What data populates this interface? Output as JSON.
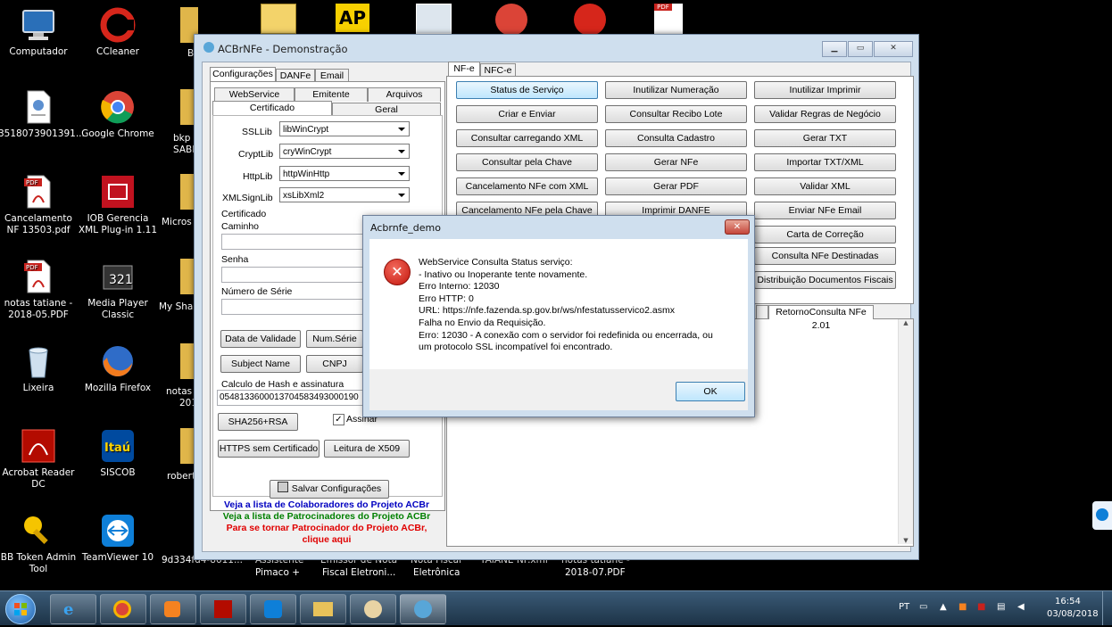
{
  "desktop": {
    "icons": [
      {
        "label": "Computador",
        "icon": "computer-icon"
      },
      {
        "label": "CCleaner",
        "icon": "ccleaner-icon"
      },
      {
        "label": "3518073901391...",
        "icon": "xml-file-icon"
      },
      {
        "label": "Google Chrome",
        "icon": "chrome-icon"
      },
      {
        "label": "Cancelamento NF 13503.pdf",
        "icon": "pdf-icon"
      },
      {
        "label": "IOB Gerencia XML Plug-in 1.11",
        "icon": "iob-icon"
      },
      {
        "label": "notas tatiane - 2018-05.PDF",
        "icon": "pdf-icon"
      },
      {
        "label": "Media Player Classic",
        "icon": "media-player-icon"
      },
      {
        "label": "Lixeira",
        "icon": "recycle-bin-icon"
      },
      {
        "label": "Mozilla Firefox",
        "icon": "firefox-icon"
      },
      {
        "label": "Acrobat Reader DC",
        "icon": "acrobat-icon"
      },
      {
        "label": "SISCOB",
        "icon": "itau-icon"
      },
      {
        "label": "BB Token Admin Tool",
        "icon": "bb-token-icon"
      },
      {
        "label": "TeamViewer 10",
        "icon": "teamviewer-icon"
      }
    ],
    "partial_labels": {
      "p1": "B",
      "p2": "bkp -",
      "p3": "SABE",
      "p4": "Micros",
      "p5": "My Shar",
      "p6": "notas",
      "p7": "201",
      "p8": "robert",
      "b1": "9d334fd4-8611...",
      "b2": "Assistente",
      "b3": "Pimaco +",
      "b4": "Emissor de Nota",
      "b5": "Fiscal Eletroni...",
      "b6": "Nota Fiscal",
      "b7": "Eletrônica",
      "b8": "TAIANE NF.xml",
      "b9": "notas tatiane -",
      "b10": "2018-07.PDF"
    },
    "top_badge": "AP",
    "top_pdf": "PDF"
  },
  "app": {
    "title": "ACBrNFe - Demonstração",
    "left_tabs": [
      "Configurações",
      "DANFe",
      "Email"
    ],
    "sub_tabs_row1": [
      "WebService",
      "Emitente",
      "Arquivos"
    ],
    "sub_tabs_row2": [
      "Certificado",
      "Geral"
    ],
    "ssl": {
      "label": "SSLLib",
      "value": "libWinCrypt"
    },
    "crypt": {
      "label": "CryptLib",
      "value": "cryWinCrypt"
    },
    "http": {
      "label": "HttpLib",
      "value": "httpWinHttp"
    },
    "xmlsign": {
      "label": "XMLSignLib",
      "value": "xsLibXml2"
    },
    "cert_group": "Certificado",
    "caminho": "Caminho",
    "senha": "Senha",
    "numero_serie": "Número de Série",
    "btn_data_validade": "Data de Validade",
    "btn_num_serie": "Num.Série",
    "btn_subject": "Subject Name",
    "btn_cnpj": "CNPJ",
    "hash_group": "Calculo de Hash e assinatura",
    "hash_value": "05481336000137045834930001​90",
    "btn_sha": "SHA256+RSA",
    "assinar": "Assinar",
    "btn_https": "HTTPS sem Certificado",
    "btn_x509": "Leitura de X509",
    "btn_salvar": "Salvar Configurações",
    "link_colab": "Veja a lista de Colaboradores do Projeto ACBr",
    "link_patro": "Veja a lista de Patrocinadores do Projeto ACBr",
    "link_tornar1": "Para se tornar Patrocinador do Projeto ACBr,",
    "link_tornar2": "clique aqui",
    "right_tabs": [
      "NF-e",
      "NFC-e"
    ],
    "actions": [
      [
        "Status de Serviço",
        "Inutilizar Numeração",
        "Inutilizar Imprimir"
      ],
      [
        "Criar e Enviar",
        "Consultar Recibo Lote",
        "Validar Regras de Negócio"
      ],
      [
        "Consultar carregando XML",
        "Consulta Cadastro",
        "Gerar TXT"
      ],
      [
        "Consultar pela Chave",
        "Gerar NFe",
        "Importar TXT/XML"
      ],
      [
        "Cancelamento NFe com XML",
        "Gerar PDF",
        "Validar XML"
      ],
      [
        "Cancelamento NFe pela Chave",
        "Imprimir DANFE",
        "Enviar NFe Email"
      ],
      [
        "",
        "",
        "Carta de Correção"
      ],
      [
        "",
        "",
        "Consulta NFe Destinadas"
      ],
      [
        "",
        "",
        "Distribuição Documentos Fiscais"
      ]
    ],
    "result_tab": "RetornoConsulta NFe 2.01"
  },
  "dialog": {
    "title": "Acbrnfe_demo",
    "message": "WebService Consulta Status serviço:\n- Inativo ou Inoperante tente novamente.\nErro Interno: 12030\nErro HTTP: 0\nURL: https://nfe.fazenda.sp.gov.br/ws/nfestatusservico2.asmx\nFalha no Envio da Requisição.\nErro: 12030 - A conexão com o servidor foi redefinida ou encerrada, ou\num protocolo SSL incompatível foi encontrado.",
    "ok_label": "OK"
  },
  "taskbar": {
    "lang": "PT",
    "time": "16:54",
    "date": "03/08/2018"
  }
}
